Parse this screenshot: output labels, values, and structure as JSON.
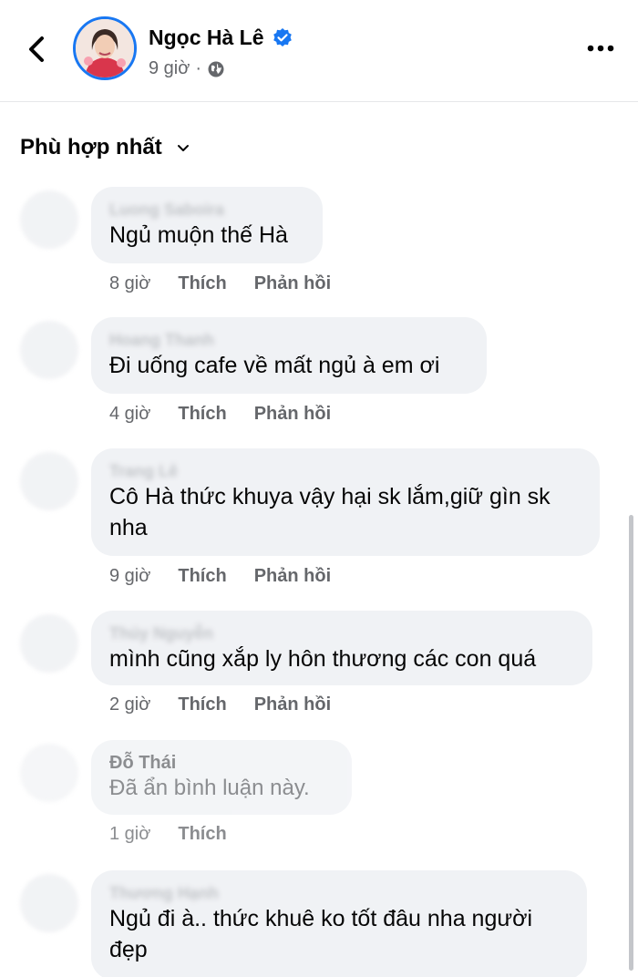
{
  "header": {
    "author_name": "Ngọc Hà Lê",
    "time": "9 giờ",
    "separator": "·",
    "verified": true,
    "icons": {
      "back": "chevron-left-icon",
      "verified": "verified-badge-icon",
      "privacy": "globe-icon",
      "more": "more-dots-icon"
    }
  },
  "sort": {
    "label": "Phù hợp nhất",
    "icon": "chevron-down-icon"
  },
  "actions": {
    "like": "Thích",
    "reply": "Phản hồi"
  },
  "comments": [
    {
      "name": "Luong Saboira",
      "text": "Ngủ muộn thế Hà",
      "time": "8 giờ"
    },
    {
      "name": "Hoang Thanh",
      "text": "Đi uống cafe về mất ngủ à em ơi",
      "time": "4 giờ"
    },
    {
      "name": "Trang Lê",
      "text": "Cô Hà thức khuya vậy hại sk lắm,giữ gìn sk nha",
      "time": "9 giờ"
    },
    {
      "name": "Thúy Nguyễn",
      "text": "mình cũng xắp ly hôn thương các con quá",
      "time": "2 giờ"
    },
    {
      "name": "Đỗ Thái",
      "text": "Đã ẩn bình luận này.",
      "time": "1 giờ"
    },
    {
      "name": "Thương Hạnh",
      "text": "Ngủ đi à.. thức khuê ko tốt đâu nha người đẹp",
      "time": ""
    }
  ],
  "colors": {
    "accent": "#1877f2",
    "bubble": "#f0f2f5",
    "secondary_text": "#65676b"
  }
}
